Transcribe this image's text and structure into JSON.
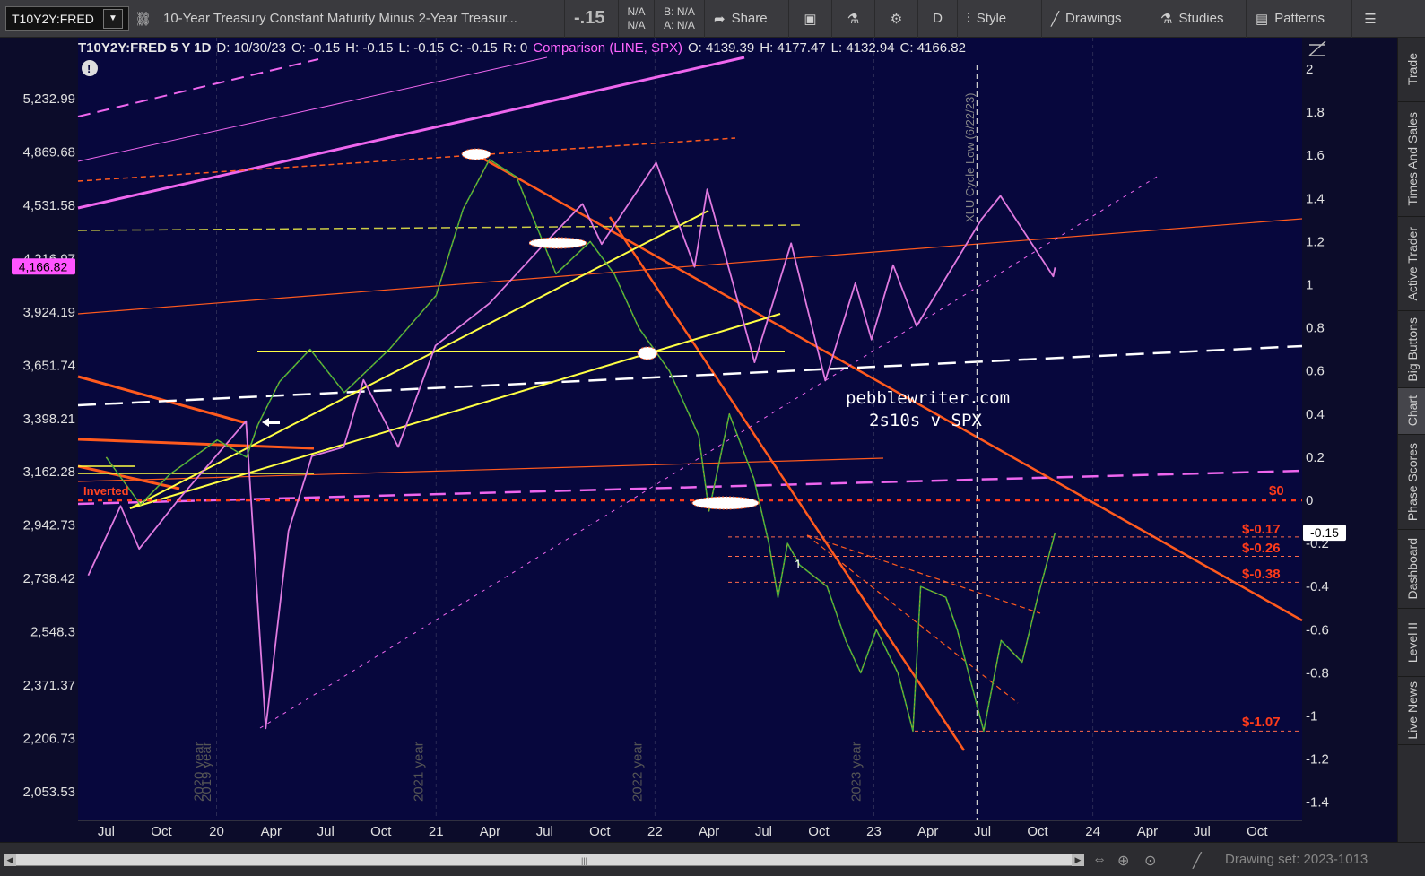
{
  "toolbar": {
    "symbol": "T10Y2Y:FRED",
    "description": "10-Year Treasury Constant Maturity Minus 2-Year Treasur...",
    "last": "-.15",
    "bid_na": "N/A",
    "ask_na": "N/A",
    "bid": "B: N/A",
    "ask": "A: N/A",
    "share": "Share",
    "period": "D",
    "style": "Style",
    "drawings": "Drawings",
    "studies": "Studies",
    "patterns": "Patterns"
  },
  "info_bar": {
    "symbol_period": "T10Y2Y:FRED 5 Y 1D",
    "date": "D: 10/30/23",
    "open": "O: -0.15",
    "high": "H: -0.15",
    "low": "L: -0.15",
    "close": "C: -0.15",
    "r": "R: 0",
    "comparison": "Comparison (LINE, SPX)",
    "cmp_open": "O: 4139.39",
    "cmp_high": "H: 4177.47",
    "cmp_low": "L: 4132.94",
    "cmp_close": "C: 4166.82"
  },
  "left_axis": {
    "ticks": [
      "5,232.99",
      "4,869.68",
      "4,531.58",
      "4,216.97",
      "3,924.19",
      "3,651.74",
      "3,398.21",
      "3,162.28",
      "2,942.73",
      "2,738.42",
      "2,548.3",
      "2,371.37",
      "2,206.73",
      "2,053.53"
    ],
    "current_label": "4,166.82"
  },
  "right_axis": {
    "ticks": [
      "2",
      "1.8",
      "1.6",
      "1.4",
      "1.2",
      "1",
      "0.8",
      "0.6",
      "0.4",
      "0.2",
      "0",
      "-0.2",
      "-0.4",
      "-0.6",
      "-0.8",
      "-1",
      "-1.2",
      "-1.4"
    ],
    "current_label": "-0.15"
  },
  "x_axis": {
    "ticks": [
      "Jul",
      "Oct",
      "20",
      "Apr",
      "Jul",
      "Oct",
      "21",
      "Apr",
      "Jul",
      "Oct",
      "22",
      "Apr",
      "Jul",
      "Oct",
      "23",
      "Apr",
      "Jul",
      "Oct",
      "24",
      "Apr",
      "Jul",
      "Oct"
    ],
    "year_markers": [
      "2019 year",
      "2020 year",
      "2021 year",
      "2022 year",
      "2023 year"
    ]
  },
  "annotations": {
    "watermark_line1": "pebblewriter.com",
    "watermark_line2": "2s10s v SPX",
    "inverted": "Inverted",
    "xlu_label": "XLU Cycle Low (6/22/23)",
    "level_zero": "$0",
    "level_1": "$-0.17",
    "level_2": "$-0.26",
    "level_3": "$-0.38",
    "level_4": "$-1.07",
    "point_marker": "1"
  },
  "right_tabs": [
    "Trade",
    "Times And Sales",
    "Active Trader",
    "Big Buttons",
    "Chart",
    "Phase Scores",
    "Dashboard",
    "Level II",
    "Live News"
  ],
  "bottom": {
    "drawing_set": "Drawing set: 2023-1013"
  },
  "colors": {
    "background": "#0c0c2a",
    "spx_line": "#e07ae0",
    "spread_line": "#3fae3f",
    "trend_orange": "#ff5a1e",
    "trend_yellow": "#ffff44",
    "trend_magenta": "#ee66ee"
  },
  "chart_data": {
    "type": "line",
    "series": [
      {
        "name": "T10Y2Y:FRED",
        "axis": "right",
        "points": [
          [
            "2019-07-01",
            0.2
          ],
          [
            "2019-08-27",
            -0.02
          ],
          [
            "2019-10-15",
            0.12
          ],
          [
            "2020-01-02",
            0.28
          ],
          [
            "2020-02-20",
            0.2
          ],
          [
            "2020-03-10",
            0.35
          ],
          [
            "2020-04-15",
            0.55
          ],
          [
            "2020-06-05",
            0.7
          ],
          [
            "2020-08-01",
            0.5
          ],
          [
            "2020-10-15",
            0.7
          ],
          [
            "2021-01-01",
            0.95
          ],
          [
            "2021-02-15",
            1.35
          ],
          [
            "2021-03-31",
            1.58
          ],
          [
            "2021-05-15",
            1.5
          ],
          [
            "2021-07-20",
            1.05
          ],
          [
            "2021-09-15",
            1.2
          ],
          [
            "2021-10-25",
            1.05
          ],
          [
            "2021-12-05",
            0.8
          ],
          [
            "2022-01-25",
            0.6
          ],
          [
            "2022-03-15",
            0.3
          ],
          [
            "2022-04-01",
            -0.05
          ],
          [
            "2022-05-05",
            0.4
          ],
          [
            "2022-06-15",
            0.1
          ],
          [
            "2022-07-10",
            -0.2
          ],
          [
            "2022-07-25",
            -0.45
          ],
          [
            "2022-08-10",
            -0.2
          ],
          [
            "2022-08-30",
            -0.3
          ],
          [
            "2022-10-15",
            -0.4
          ],
          [
            "2022-11-15",
            -0.65
          ],
          [
            "2022-12-10",
            -0.8
          ],
          [
            "2023-01-05",
            -0.6
          ],
          [
            "2023-02-10",
            -0.8
          ],
          [
            "2023-03-07",
            -1.07
          ],
          [
            "2023-03-20",
            -0.4
          ],
          [
            "2023-05-01",
            -0.45
          ],
          [
            "2023-05-20",
            -0.6
          ],
          [
            "2023-07-03",
            -1.07
          ],
          [
            "2023-08-01",
            -0.65
          ],
          [
            "2023-09-05",
            -0.75
          ],
          [
            "2023-10-01",
            -0.45
          ],
          [
            "2023-10-30",
            -0.15
          ]
        ]
      },
      {
        "name": "SPX",
        "axis": "left",
        "points": [
          [
            "2019-06-01",
            2750
          ],
          [
            "2019-07-25",
            3020
          ],
          [
            "2019-08-25",
            2850
          ],
          [
            "2019-10-31",
            3050
          ],
          [
            "2019-12-31",
            3230
          ],
          [
            "2020-02-19",
            3386
          ],
          [
            "2020-03-23",
            2237
          ],
          [
            "2020-04-30",
            2920
          ],
          [
            "2020-06-08",
            3230
          ],
          [
            "2020-07-31",
            3270
          ],
          [
            "2020-09-02",
            3580
          ],
          [
            "2020-10-30",
            3270
          ],
          [
            "2020-12-31",
            3750
          ],
          [
            "2021-03-31",
            3970
          ],
          [
            "2021-06-30",
            4300
          ],
          [
            "2021-09-02",
            4540
          ],
          [
            "2021-10-04",
            4300
          ],
          [
            "2022-01-03",
            4800
          ],
          [
            "2022-03-08",
            4170
          ],
          [
            "2022-03-29",
            4630
          ],
          [
            "2022-06-16",
            3666
          ],
          [
            "2022-08-16",
            4305
          ],
          [
            "2022-10-12",
            3577
          ],
          [
            "2022-12-01",
            4080
          ],
          [
            "2022-12-28",
            3780
          ],
          [
            "2023-02-02",
            4180
          ],
          [
            "2023-03-13",
            3850
          ],
          [
            "2023-06-30",
            4450
          ],
          [
            "2023-07-31",
            4589
          ],
          [
            "2023-10-27",
            4117
          ],
          [
            "2023-10-30",
            4166.82
          ]
        ]
      }
    ],
    "y_left_range": [
      2000,
      5400
    ],
    "y_right_range": [
      -1.5,
      2.1
    ],
    "x_range": [
      "2019-05-15",
      "2024-12-15"
    ],
    "levels": [
      0,
      -0.17,
      -0.26,
      -0.38,
      -1.07
    ]
  }
}
